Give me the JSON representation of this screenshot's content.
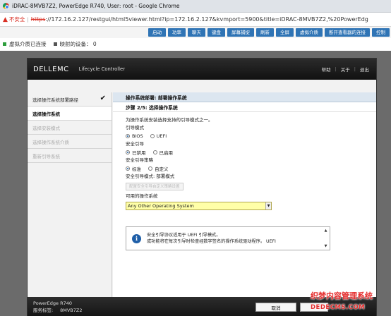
{
  "window": {
    "title": "iDRAC-8MVB7Z2, PowerEdge R740, User: root - Google Chrome"
  },
  "address_bar": {
    "security_label": "不安全",
    "url_scheme": "https",
    "url_rest": "://172.16.2.127/restgui/html5viewer.html?ip=172.16.2.127&kvmport=5900&title=iDRAC-8MVB7Z2,%20PowerEdg"
  },
  "viewer_toolbar": {
    "buttons": [
      "启动",
      "功率",
      "聊天",
      "键盘",
      "屏幕捕捉",
      "刷新",
      "全屏",
      "虚拟介质",
      "断开查看器的连接",
      "控制"
    ]
  },
  "status_bar": {
    "media_connected": "虚拟介质已连接",
    "mapped_devices": "映射的设备： 0"
  },
  "lifecycle": {
    "brand": "DELLEMC",
    "app_title": "Lifecycle Controller",
    "header_links": [
      "帮助",
      "关于",
      "退出"
    ],
    "sidebar": [
      {
        "label": "选择操作系统部署路径",
        "state": "done"
      },
      {
        "label": "选择操作系统",
        "state": "active"
      },
      {
        "label": "选择安装模式",
        "state": "disabled"
      },
      {
        "label": "选择操作系统介质",
        "state": "disabled"
      },
      {
        "label": "重新引导系统",
        "state": "disabled"
      }
    ],
    "page_title": "操作系统部署: 部署操作系统",
    "step_title": "步骤 2/5: 选择操作系统",
    "instruction": "为操作系统安装选择支持的引导模式之一。",
    "boot_mode": {
      "label": "引导模式",
      "options": [
        "BIOS",
        "UEFI"
      ],
      "selected": "BIOS"
    },
    "secure_boot": {
      "label": "安全引导",
      "options": [
        "已禁用",
        "已启用"
      ],
      "selected": "已禁用"
    },
    "secure_boot_policy": {
      "label": "安全引导策略",
      "options": [
        "标准",
        "自定义"
      ],
      "selected": "标准"
    },
    "secure_boot_mode": "安全引导模式: 部署模式",
    "custom_policy_button": "配置安全引导自定义策略设置",
    "available_os_label": "可用的操作系统",
    "selected_os": "Any Other Operating System",
    "info_lines": [
      "安全引导协议适用于 UEFI 引导模式。",
      "成功能将在每次引导时检查经数字签名的操作系统驱动程序。 UEFI"
    ],
    "footer": {
      "model": "PowerEdge R740",
      "service_tag_label": "服务标签:",
      "service_tag": "8MVB7Z2"
    },
    "cancel_button": "取消"
  },
  "watermark": {
    "line1": "织梦内容管理系统",
    "line2": "DEDECMS.COM"
  },
  "colors": {
    "toolbar_button": "#2f74b5",
    "insecure": "#d93025",
    "select_highlight": "#ffffa8",
    "header_dark": "#1a1a1a",
    "info_icon": "#1f5fa8"
  }
}
